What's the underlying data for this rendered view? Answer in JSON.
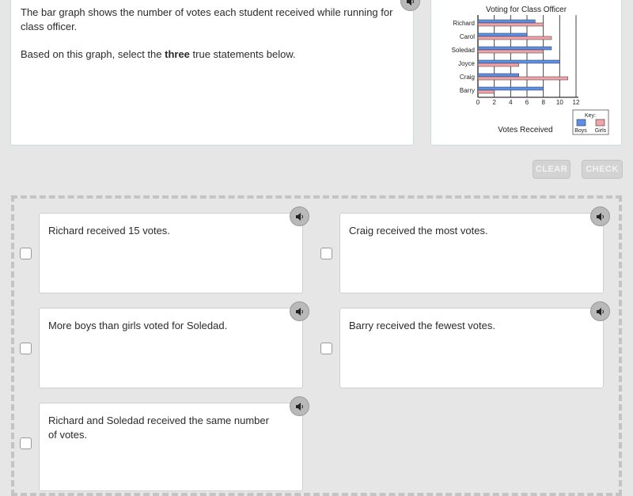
{
  "prompt": {
    "line1": "The bar graph shows the number of votes each student received while running for class officer.",
    "line2_pre": "Based on this graph, select the ",
    "line2_bold": "three",
    "line2_post": " true statements below.",
    "audio_icon": "speaker-icon"
  },
  "chart_data": {
    "type": "bar",
    "orientation": "horizontal",
    "title": "Voting for Class Officer",
    "xlabel": "Votes Received",
    "ylabel": "",
    "categories": [
      "Richard",
      "Carol",
      "Soledad",
      "Joyce",
      "Craig",
      "Barry"
    ],
    "series": [
      {
        "name": "Boys",
        "color": "#5b8fe8",
        "values": [
          7,
          6,
          9,
          10,
          5,
          8
        ]
      },
      {
        "name": "Girls",
        "color": "#f2a3a8",
        "values": [
          8,
          9,
          8,
          5,
          11,
          2
        ]
      }
    ],
    "xlim": [
      0,
      12
    ],
    "xticks": [
      "0",
      "2",
      "4",
      "6",
      "8",
      "10",
      "12"
    ],
    "grid": true,
    "legend": {
      "title": "Key:",
      "placement": "bottom-right",
      "entries": [
        "Boys",
        "Girls"
      ]
    }
  },
  "buttons": {
    "clear": "CLEAR",
    "check": "CHECK"
  },
  "options": [
    {
      "text": "Richard received 15 votes.",
      "checked": false
    },
    {
      "text": "Craig received the most votes.",
      "checked": false
    },
    {
      "text": "More boys than girls voted for Soledad.",
      "checked": false
    },
    {
      "text": "Barry received the fewest votes.",
      "checked": false
    },
    {
      "text": "Richard and Soledad received the same number of votes.",
      "checked": false
    }
  ]
}
